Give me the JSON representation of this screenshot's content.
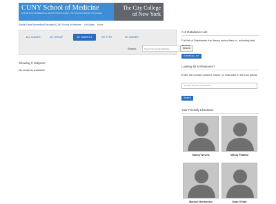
{
  "banner": {
    "title": "CUNY School of Medicine",
    "subtitle": "SOPHIE DAVIS BIOMEDICAL EDUCATION PROGRAM · PHYSICIAN ASSISTANT PROGRAM",
    "college_line1": "The City College",
    "college_line2": "of New York"
  },
  "breadcrumbs": [
    "Sophie Davis Biomedical Education/CUNY School of Medicine",
    "LibGuides",
    "Home"
  ],
  "tabs": [
    {
      "label": "ALL GUIDES",
      "active": false
    },
    {
      "label": "BY GROUP",
      "active": false
    },
    {
      "label": "BY SUBJECT",
      "active": true
    },
    {
      "label": "BY TYPE",
      "active": false
    },
    {
      "label": "BY OWNER",
      "active": false
    }
  ],
  "search": {
    "label": "Search:",
    "placeholder": "Search this Library Website",
    "button": "Search"
  },
  "main": {
    "showing": "Showing 0 Subjects",
    "empty_message": "No subjects available."
  },
  "sidebar": {
    "az": {
      "heading": "A-Z Databases List",
      "text": "Full list of Databases the library subscribes to, including trial access.",
      "button": "DATABASE LIST"
    },
    "reserves": {
      "heading": "Looking for E-Reserves?",
      "text": "Enter the course number, name, or instructor in the box below.",
      "placeholder": "Course number or instructor",
      "button": "Search"
    },
    "librarians": {
      "heading": "Your Friendly Librarians",
      "people": [
        {
          "name": "Stacey Nevels"
        },
        {
          "name": "Manoj Padaral"
        },
        {
          "name": "Marisol Hernandez"
        },
        {
          "name": "Sean O'Hair"
        }
      ]
    }
  },
  "colors": {
    "accent": "#2a6ebb",
    "banner_blue": "#3d8ed6",
    "banner_gray": "#62656c"
  }
}
